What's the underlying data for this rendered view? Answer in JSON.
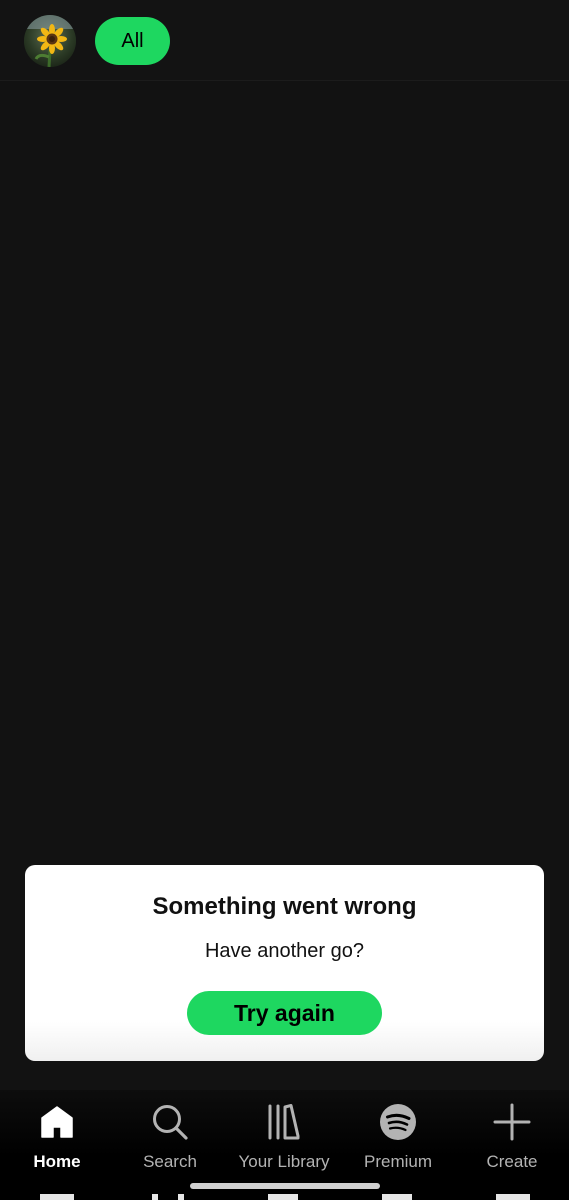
{
  "header": {
    "avatar_alt": "profile",
    "filter_chip_label": "All"
  },
  "error_card": {
    "title": "Something went wrong",
    "subtitle": "Have another go?",
    "retry_label": "Try again"
  },
  "bottom_nav": {
    "items": [
      {
        "label": "Home",
        "icon": "home-icon",
        "active": true
      },
      {
        "label": "Search",
        "icon": "search-icon",
        "active": false
      },
      {
        "label": "Your Library",
        "icon": "library-icon",
        "active": false
      },
      {
        "label": "Premium",
        "icon": "spotify-icon",
        "active": false
      },
      {
        "label": "Create",
        "icon": "plus-icon",
        "active": false
      }
    ]
  },
  "colors": {
    "accent": "#1ed760",
    "background": "#121212",
    "card": "#ffffff",
    "nav_inactive": "#b3b3b3",
    "nav_active": "#ffffff"
  }
}
